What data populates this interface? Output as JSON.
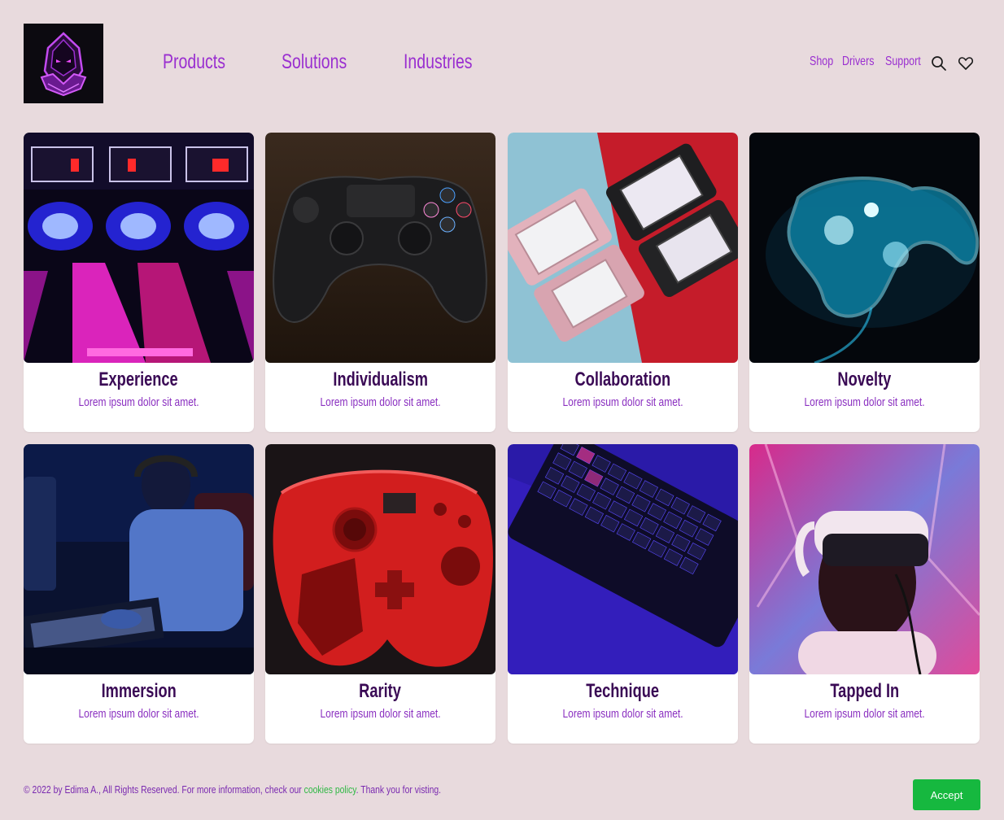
{
  "header": {
    "logo_alt": "hooded gamer logo",
    "nav": [
      {
        "label": "Products"
      },
      {
        "label": "Solutions"
      },
      {
        "label": "Industries"
      }
    ],
    "util": [
      {
        "label": "Shop"
      },
      {
        "label": "Drivers"
      },
      {
        "label": "Support"
      }
    ],
    "icons": [
      "search-icon",
      "heart-icon"
    ]
  },
  "cards": [
    {
      "title": "Experience",
      "desc": "Lorem ipsum dolor sit amet.",
      "image": "arcade skee-ball lanes"
    },
    {
      "title": "Individualism",
      "desc": "Lorem ipsum dolor sit amet.",
      "image": "black game controller"
    },
    {
      "title": "Collaboration",
      "desc": "Lorem ipsum dolor sit amet.",
      "image": "two handheld consoles"
    },
    {
      "title": "Novelty",
      "desc": "Lorem ipsum dolor sit amet.",
      "image": "glowing blue controller"
    },
    {
      "title": "Immersion",
      "desc": "Lorem ipsum dolor sit amet.",
      "image": "gamer at keyboard"
    },
    {
      "title": "Rarity",
      "desc": "Lorem ipsum dolor sit amet.",
      "image": "red game controller"
    },
    {
      "title": "Technique",
      "desc": "Lorem ipsum dolor sit amet.",
      "image": "backlit keyboard"
    },
    {
      "title": "Tapped In",
      "desc": "Lorem ipsum dolor sit amet.",
      "image": "person in VR headset"
    }
  ],
  "footer": {
    "text_before": "© 2022 by Edima A., All Rights Reserved. For more information, check our ",
    "link": "cookies policy",
    "text_after": ". Thank you for visting.",
    "accept": "Accept"
  },
  "colors": {
    "background": "#e8dadd",
    "accent": "#9a2fd0",
    "title": "#3a0a55",
    "accept": "#16b83f"
  }
}
